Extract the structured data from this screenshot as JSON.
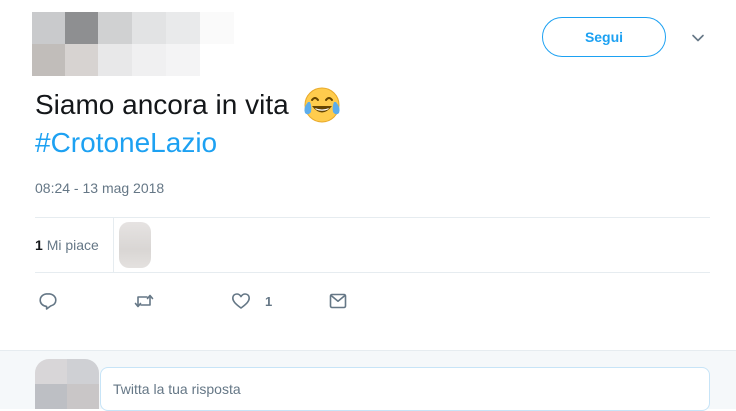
{
  "header": {
    "follow_label": "Segui",
    "menu_icon": "chevron-down-icon"
  },
  "tweet": {
    "text": "Siamo ancora in vita",
    "emoji": "face-with-tears-of-joy",
    "hashtag": "#CrotoneLazio",
    "timestamp": "08:24 - 13 mag 2018"
  },
  "stats": {
    "like_count": "1",
    "like_label": "Mi piace"
  },
  "actions": {
    "reply_icon": "reply-icon",
    "retweet_icon": "retweet-icon",
    "like_icon": "heart-icon",
    "like_count": "1",
    "dm_icon": "envelope-icon"
  },
  "reply": {
    "placeholder": "Twitta la tua risposta"
  },
  "colors": {
    "accent": "#1da1f2",
    "muted": "#657786",
    "divider": "#e6ecf0"
  }
}
